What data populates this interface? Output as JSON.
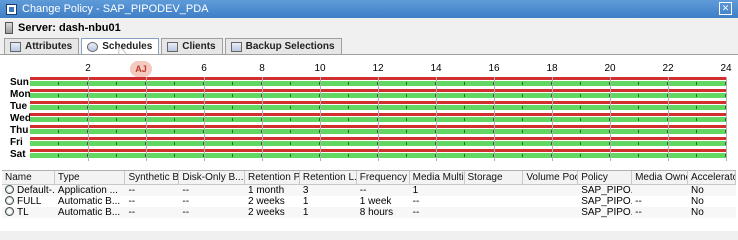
{
  "window": {
    "title": "Change Policy - SAP_PIPODEV_PDA",
    "server_label": "Server: dash-nbu01"
  },
  "tabs": [
    {
      "label": "Attributes",
      "active": false
    },
    {
      "label": "Schedules",
      "active": true
    },
    {
      "label": "Clients",
      "active": false
    },
    {
      "label": "Backup Selections",
      "active": false
    }
  ],
  "schedule_grid": {
    "hour_labels": [
      "2",
      "4",
      "6",
      "8",
      "10",
      "12",
      "14",
      "16",
      "18",
      "20",
      "22",
      "24"
    ],
    "badge": "AJ",
    "days": [
      "Sun",
      "Mon",
      "Tue",
      "Wed",
      "Thu",
      "Fri",
      "Sat"
    ]
  },
  "table": {
    "columns": [
      "Name",
      "Type",
      "Synthetic B...",
      "Disk-Only B...",
      "Retention P...",
      "Retention L...",
      "Frequency",
      "Media Multi...",
      "Storage",
      "Volume Pool",
      "Policy",
      "Media Owner",
      "Accelerator ..."
    ],
    "rows": [
      [
        "Default-...",
        "Application ...",
        "--",
        "--",
        "1 month",
        "3",
        "--",
        "1",
        "",
        "",
        "SAP_PIPO...",
        "",
        "No"
      ],
      [
        "FULL",
        "Automatic B...",
        "--",
        "--",
        "2 weeks",
        "1",
        "1 week",
        "--",
        "",
        "",
        "SAP_PIPO...",
        "--",
        "No"
      ],
      [
        "TL",
        "Automatic B...",
        "--",
        "--",
        "2 weeks",
        "1",
        "8 hours",
        "--",
        "",
        "",
        "SAP_PIPO...",
        "--",
        "No"
      ]
    ]
  }
}
